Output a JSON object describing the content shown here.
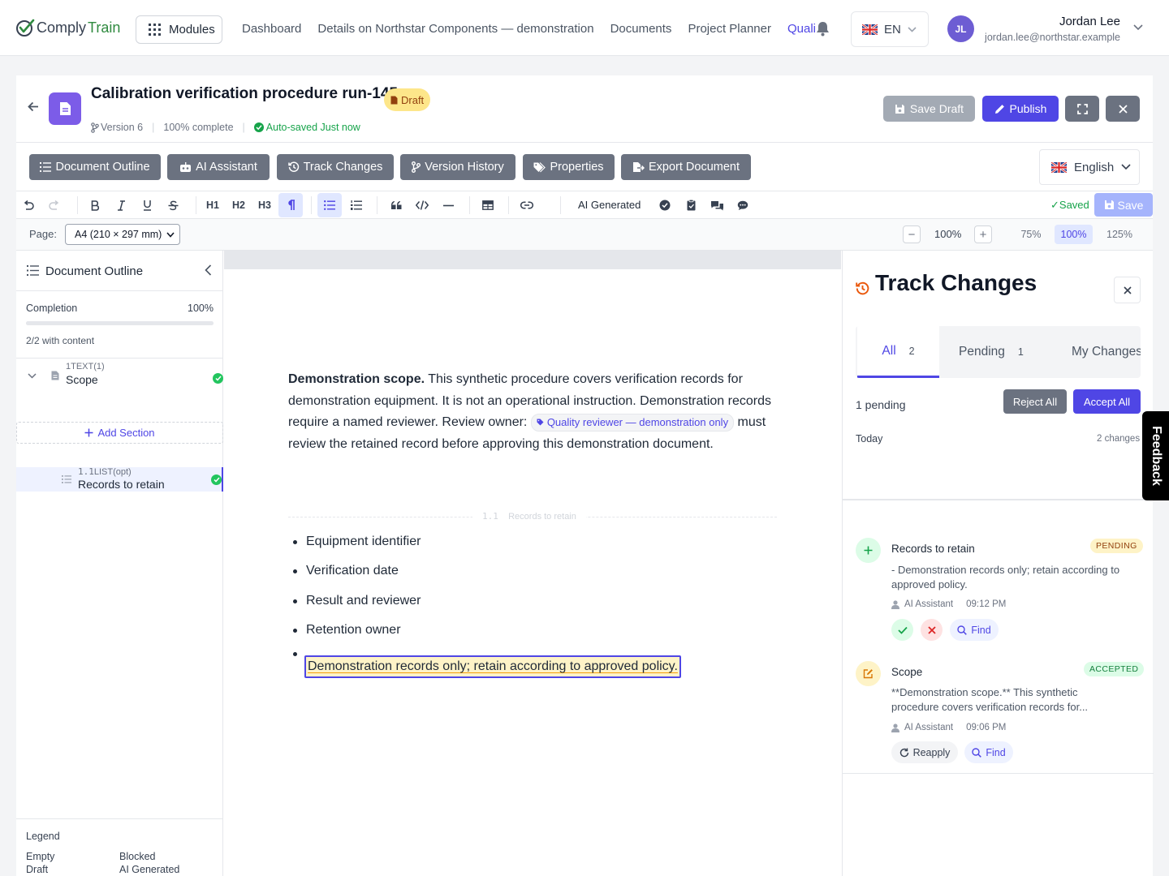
{
  "nav": {
    "logo_prefix": "Comply",
    "logo_suffix": "Train",
    "modules_label": "Modules",
    "links": [
      "Dashboard",
      "Details on Northstar Components — demonstration",
      "Documents",
      "Project Planner",
      "Quali"
    ],
    "active_link": "Quali",
    "language": "EN",
    "user_initials": "JL",
    "user_name": "Jordan Lee",
    "user_email": "jordan.lee@northstar.example"
  },
  "doc": {
    "title": "Calibration verification procedure run-145",
    "status_badge": "Draft",
    "version": "Version 6",
    "completeness": "100% complete",
    "autosave": "Auto-saved Just now",
    "save_draft_label": "Save Draft",
    "publish_label": "Publish"
  },
  "toolbar": {
    "buttons": [
      "Document Outline",
      "AI Assistant",
      "Track Changes",
      "Version History",
      "Properties",
      "Export Document"
    ],
    "language_label": "English"
  },
  "format_toolbar": {
    "headings": [
      "H1",
      "H2",
      "H3"
    ],
    "ai_generated_label": "AI Generated",
    "saved_label": "✓Saved",
    "save_label": "Save"
  },
  "page_bar": {
    "page_label": "Page:",
    "page_size": "A4 (210 × 297 mm)",
    "zoom_value": "100%",
    "zoom_presets": [
      "75%",
      "100%",
      "125%"
    ],
    "active_zoom": "100%"
  },
  "outline": {
    "title": "Document Outline",
    "completion_label": "Completion",
    "completion_value": "100%",
    "completion_fraction": 1.0,
    "content_count": "2/2 with content",
    "sections": [
      {
        "number": "1",
        "type": "TEXT(1)",
        "name": "Scope",
        "complete": true
      },
      {
        "number": "1.1",
        "type": "LIST(opt)",
        "name": "Records to retain",
        "complete": true
      }
    ],
    "add_section_label": "Add Section",
    "legend_title": "Legend",
    "legend_items": [
      "Empty",
      "Blocked",
      "Draft",
      "AI Generated"
    ]
  },
  "editor": {
    "scope_lead": "Demonstration scope.",
    "scope_text": " This synthetic procedure covers verification records for demonstration equipment. It is not an operational instruction. Demonstration records require a named reviewer. Review owner: ",
    "reviewer_chip": "Quality reviewer — demonstration only",
    "scope_tail": " must review the retained record before ap­proving this demonstration document.",
    "section_divider_number": "1.1",
    "section_divider_label": "Records to retain",
    "list_items": [
      "Equipment identifier",
      "Verification date",
      "Result and reviewer",
      "Retention owner"
    ],
    "highlighted_item": "Demonstration records only; retain according to approved policy."
  },
  "track_changes": {
    "title": "Track Changes",
    "tabs": [
      {
        "label": "All",
        "count": "2"
      },
      {
        "label": "Pending",
        "count": "1"
      },
      {
        "label": "My Changes",
        "count": ""
      }
    ],
    "pending_summary": "1 pending",
    "reject_all_label": "Reject All",
    "accept_all_label": "Accept All",
    "group_label": "Today",
    "group_count": "2 changes",
    "changes": [
      {
        "title": "Records to retain",
        "status": "PENDING",
        "body": "- Demonstration records only; retain according to approved policy.",
        "author": "AI Assistant",
        "time": "09:12 PM",
        "find_label": "Find"
      },
      {
        "title": "Scope",
        "status": "ACCEPTED",
        "body": "**Demonstration scope.** This synthetic procedure covers verification records for...",
        "author": "AI Assistant",
        "time": "09:06 PM",
        "reapply_label": "Reapply",
        "find_label": "Find"
      }
    ]
  },
  "feedback_label": "Feedback",
  "colors": {
    "accent": "#4f46e5",
    "success": "#22c55e",
    "pending_badge": "#fef3c7",
    "accepted_badge": "#dcfce7",
    "draft_badge": "#fde68a"
  }
}
